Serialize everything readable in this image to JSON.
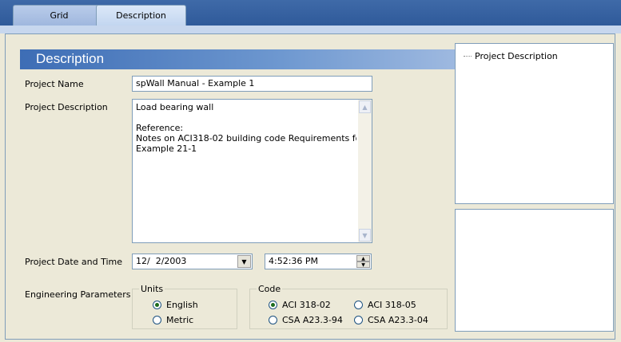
{
  "tabs": [
    {
      "label": "Grid"
    },
    {
      "label": "Description"
    }
  ],
  "header": {
    "title": "Description"
  },
  "form": {
    "project_name": {
      "label": "Project Name",
      "value": "spWall Manual - Example 1"
    },
    "project_description": {
      "label": "Project Description",
      "value": "Load bearing wall\n\nReference:\nNotes on ACI318-02 building code Requirements for Struc\nExample 21-1"
    },
    "date_time": {
      "label": "Project Date and Time",
      "date": "12/  2/2003",
      "time": "4:52:36 PM"
    },
    "engineering": {
      "label": "Engineering Parameters",
      "units": {
        "title": "Units",
        "options": [
          "English",
          "Metric"
        ],
        "selected": "English"
      },
      "code": {
        "title": "Code",
        "options": [
          "ACI 318-02",
          "ACI 318-05",
          "CSA A23.3-94",
          "CSA A23.3-04"
        ],
        "selected": "ACI 318-02"
      }
    }
  },
  "tree": {
    "items": [
      "Project Description"
    ]
  }
}
